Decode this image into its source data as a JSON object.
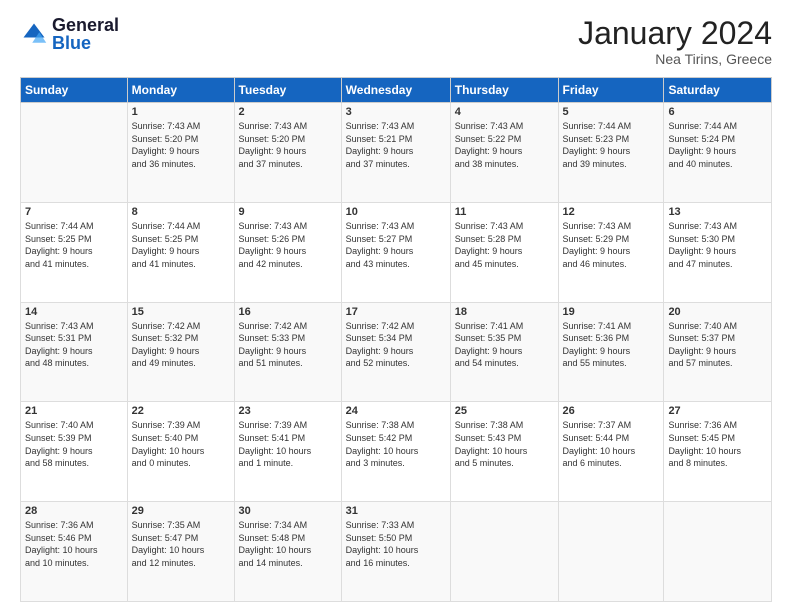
{
  "logo": {
    "general": "General",
    "blue": "Blue"
  },
  "title": "January 2024",
  "location": "Nea Tirins, Greece",
  "days_header": [
    "Sunday",
    "Monday",
    "Tuesday",
    "Wednesday",
    "Thursday",
    "Friday",
    "Saturday"
  ],
  "weeks": [
    [
      {
        "num": "",
        "info": ""
      },
      {
        "num": "1",
        "info": "Sunrise: 7:43 AM\nSunset: 5:20 PM\nDaylight: 9 hours\nand 36 minutes."
      },
      {
        "num": "2",
        "info": "Sunrise: 7:43 AM\nSunset: 5:20 PM\nDaylight: 9 hours\nand 37 minutes."
      },
      {
        "num": "3",
        "info": "Sunrise: 7:43 AM\nSunset: 5:21 PM\nDaylight: 9 hours\nand 37 minutes."
      },
      {
        "num": "4",
        "info": "Sunrise: 7:43 AM\nSunset: 5:22 PM\nDaylight: 9 hours\nand 38 minutes."
      },
      {
        "num": "5",
        "info": "Sunrise: 7:44 AM\nSunset: 5:23 PM\nDaylight: 9 hours\nand 39 minutes."
      },
      {
        "num": "6",
        "info": "Sunrise: 7:44 AM\nSunset: 5:24 PM\nDaylight: 9 hours\nand 40 minutes."
      }
    ],
    [
      {
        "num": "7",
        "info": "Sunrise: 7:44 AM\nSunset: 5:25 PM\nDaylight: 9 hours\nand 41 minutes."
      },
      {
        "num": "8",
        "info": "Sunrise: 7:44 AM\nSunset: 5:25 PM\nDaylight: 9 hours\nand 41 minutes."
      },
      {
        "num": "9",
        "info": "Sunrise: 7:43 AM\nSunset: 5:26 PM\nDaylight: 9 hours\nand 42 minutes."
      },
      {
        "num": "10",
        "info": "Sunrise: 7:43 AM\nSunset: 5:27 PM\nDaylight: 9 hours\nand 43 minutes."
      },
      {
        "num": "11",
        "info": "Sunrise: 7:43 AM\nSunset: 5:28 PM\nDaylight: 9 hours\nand 45 minutes."
      },
      {
        "num": "12",
        "info": "Sunrise: 7:43 AM\nSunset: 5:29 PM\nDaylight: 9 hours\nand 46 minutes."
      },
      {
        "num": "13",
        "info": "Sunrise: 7:43 AM\nSunset: 5:30 PM\nDaylight: 9 hours\nand 47 minutes."
      }
    ],
    [
      {
        "num": "14",
        "info": "Sunrise: 7:43 AM\nSunset: 5:31 PM\nDaylight: 9 hours\nand 48 minutes."
      },
      {
        "num": "15",
        "info": "Sunrise: 7:42 AM\nSunset: 5:32 PM\nDaylight: 9 hours\nand 49 minutes."
      },
      {
        "num": "16",
        "info": "Sunrise: 7:42 AM\nSunset: 5:33 PM\nDaylight: 9 hours\nand 51 minutes."
      },
      {
        "num": "17",
        "info": "Sunrise: 7:42 AM\nSunset: 5:34 PM\nDaylight: 9 hours\nand 52 minutes."
      },
      {
        "num": "18",
        "info": "Sunrise: 7:41 AM\nSunset: 5:35 PM\nDaylight: 9 hours\nand 54 minutes."
      },
      {
        "num": "19",
        "info": "Sunrise: 7:41 AM\nSunset: 5:36 PM\nDaylight: 9 hours\nand 55 minutes."
      },
      {
        "num": "20",
        "info": "Sunrise: 7:40 AM\nSunset: 5:37 PM\nDaylight: 9 hours\nand 57 minutes."
      }
    ],
    [
      {
        "num": "21",
        "info": "Sunrise: 7:40 AM\nSunset: 5:39 PM\nDaylight: 9 hours\nand 58 minutes."
      },
      {
        "num": "22",
        "info": "Sunrise: 7:39 AM\nSunset: 5:40 PM\nDaylight: 10 hours\nand 0 minutes."
      },
      {
        "num": "23",
        "info": "Sunrise: 7:39 AM\nSunset: 5:41 PM\nDaylight: 10 hours\nand 1 minute."
      },
      {
        "num": "24",
        "info": "Sunrise: 7:38 AM\nSunset: 5:42 PM\nDaylight: 10 hours\nand 3 minutes."
      },
      {
        "num": "25",
        "info": "Sunrise: 7:38 AM\nSunset: 5:43 PM\nDaylight: 10 hours\nand 5 minutes."
      },
      {
        "num": "26",
        "info": "Sunrise: 7:37 AM\nSunset: 5:44 PM\nDaylight: 10 hours\nand 6 minutes."
      },
      {
        "num": "27",
        "info": "Sunrise: 7:36 AM\nSunset: 5:45 PM\nDaylight: 10 hours\nand 8 minutes."
      }
    ],
    [
      {
        "num": "28",
        "info": "Sunrise: 7:36 AM\nSunset: 5:46 PM\nDaylight: 10 hours\nand 10 minutes."
      },
      {
        "num": "29",
        "info": "Sunrise: 7:35 AM\nSunset: 5:47 PM\nDaylight: 10 hours\nand 12 minutes."
      },
      {
        "num": "30",
        "info": "Sunrise: 7:34 AM\nSunset: 5:48 PM\nDaylight: 10 hours\nand 14 minutes."
      },
      {
        "num": "31",
        "info": "Sunrise: 7:33 AM\nSunset: 5:50 PM\nDaylight: 10 hours\nand 16 minutes."
      },
      {
        "num": "",
        "info": ""
      },
      {
        "num": "",
        "info": ""
      },
      {
        "num": "",
        "info": ""
      }
    ]
  ]
}
